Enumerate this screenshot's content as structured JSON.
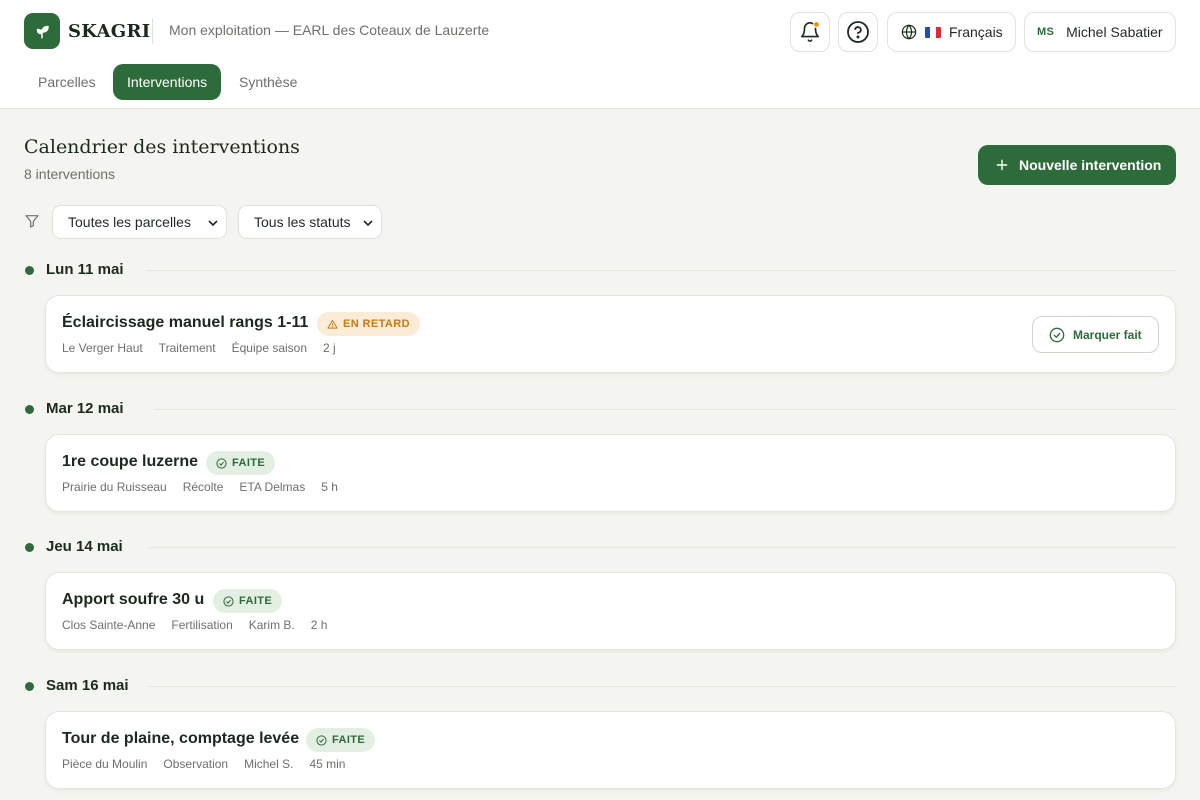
{
  "header": {
    "brand": "SKAGRI",
    "farm_label": "Mon exploitation — EARL des Coteaux de Lauzerte",
    "language": "Français",
    "user": {
      "initials": "MS",
      "name": "Michel Sabatier"
    },
    "has_notification": true
  },
  "tabs": [
    {
      "label": "Parcelles",
      "active": false
    },
    {
      "label": "Interventions",
      "active": true
    },
    {
      "label": "Synthèse",
      "active": false
    }
  ],
  "main": {
    "title": "Calendrier des interventions",
    "count": "8 interventions",
    "new_button": "Nouvelle intervention",
    "filters": {
      "parcel": "Toutes les parcelles",
      "status": "Tous les statuts"
    }
  },
  "days": [
    {
      "label": "Lun 11 mai",
      "intervention": {
        "title": "Éclaircissage manuel rangs 1-11",
        "status": "EN RETARD",
        "status_type": "late",
        "meta": [
          "Le Verger Haut",
          "Traitement",
          "Équipe saison",
          "2 j"
        ],
        "action": "Marquer fait"
      }
    },
    {
      "label": "Mar 12 mai",
      "intervention": {
        "title": "1re coupe luzerne",
        "status": "FAITE",
        "status_type": "done",
        "meta": [
          "Prairie du Ruisseau",
          "Récolte",
          "ETA Delmas",
          "5 h"
        ]
      }
    },
    {
      "label": "Jeu 14 mai",
      "intervention": {
        "title": "Apport soufre 30 u",
        "status": "FAITE",
        "status_type": "done",
        "meta": [
          "Clos Sainte-Anne",
          "Fertilisation",
          "Karim B.",
          "2 h"
        ]
      }
    },
    {
      "label": "Sam 16 mai",
      "intervention": {
        "title": "Tour de plaine, comptage levée",
        "status": "FAITE",
        "status_type": "done",
        "meta": [
          "Pièce du Moulin",
          "Observation",
          "Michel S.",
          "45 min"
        ]
      }
    }
  ],
  "colors": {
    "brand_green": "#2e6b3a",
    "late_bg": "#fbecd7",
    "late_fg": "#c77a12",
    "done_bg": "#e4efe3",
    "notification": "#e39a1c"
  }
}
